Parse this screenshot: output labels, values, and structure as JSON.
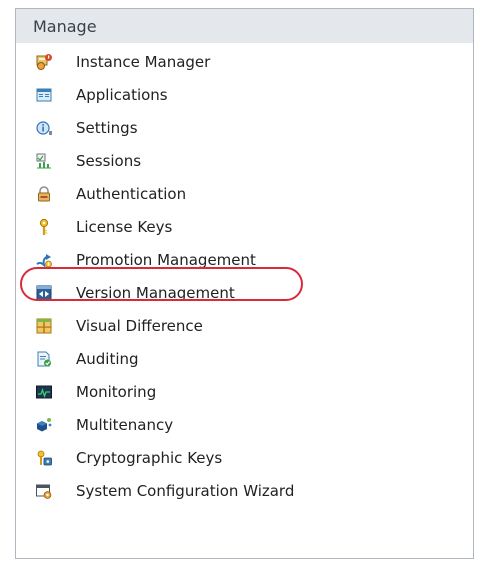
{
  "panel": {
    "title": "Manage"
  },
  "items": [
    {
      "label": "Instance Manager",
      "icon": "instance-manager-icon"
    },
    {
      "label": "Applications",
      "icon": "applications-icon"
    },
    {
      "label": "Settings",
      "icon": "settings-icon"
    },
    {
      "label": "Sessions",
      "icon": "sessions-icon"
    },
    {
      "label": "Authentication",
      "icon": "authentication-icon"
    },
    {
      "label": "License Keys",
      "icon": "license-keys-icon"
    },
    {
      "label": "Promotion Management",
      "icon": "promotion-management-icon"
    },
    {
      "label": "Version Management",
      "icon": "version-management-icon"
    },
    {
      "label": "Visual Difference",
      "icon": "visual-difference-icon"
    },
    {
      "label": "Auditing",
      "icon": "auditing-icon"
    },
    {
      "label": "Monitoring",
      "icon": "monitoring-icon"
    },
    {
      "label": "Multitenancy",
      "icon": "multitenancy-icon"
    },
    {
      "label": "Cryptographic Keys",
      "icon": "cryptographic-keys-icon"
    },
    {
      "label": "System Configuration Wizard",
      "icon": "system-configuration-wizard-icon"
    }
  ],
  "highlight": {
    "target": "Promotion Management",
    "color": "#d92a3a"
  }
}
